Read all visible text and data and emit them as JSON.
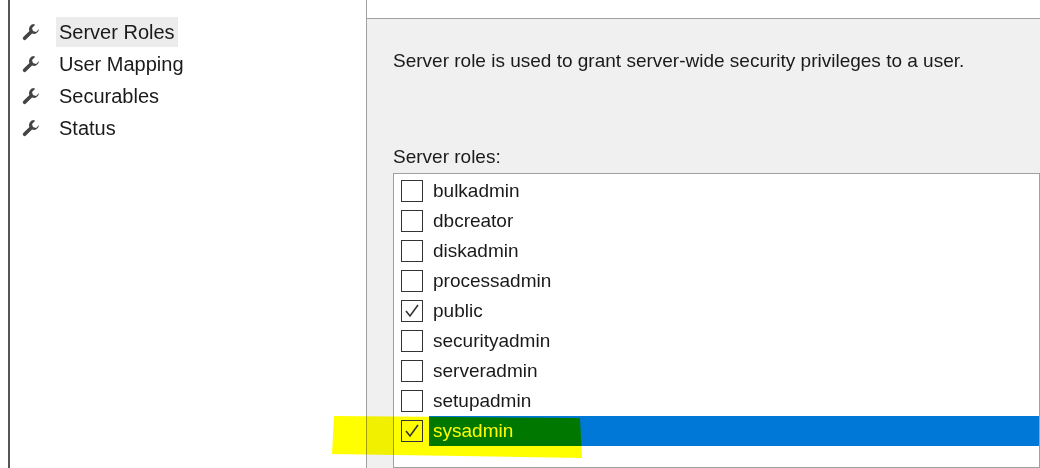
{
  "sidebar": {
    "items": [
      {
        "label": "Server Roles",
        "selected": true
      },
      {
        "label": "User Mapping",
        "selected": false
      },
      {
        "label": "Securables",
        "selected": false
      },
      {
        "label": "Status",
        "selected": false
      }
    ]
  },
  "description": "Server role is used to grant server-wide security privileges to a user.",
  "roles": {
    "label": "Server roles:",
    "items": [
      {
        "label": "bulkadmin",
        "checked": false,
        "selected": false,
        "highlighted": false
      },
      {
        "label": "dbcreator",
        "checked": false,
        "selected": false,
        "highlighted": false
      },
      {
        "label": "diskadmin",
        "checked": false,
        "selected": false,
        "highlighted": false
      },
      {
        "label": "processadmin",
        "checked": false,
        "selected": false,
        "highlighted": false
      },
      {
        "label": "public",
        "checked": true,
        "selected": false,
        "highlighted": false
      },
      {
        "label": "securityadmin",
        "checked": false,
        "selected": false,
        "highlighted": false
      },
      {
        "label": "serveradmin",
        "checked": false,
        "selected": false,
        "highlighted": false
      },
      {
        "label": "setupadmin",
        "checked": false,
        "selected": false,
        "highlighted": false
      },
      {
        "label": "sysadmin",
        "checked": true,
        "selected": true,
        "highlighted": true
      }
    ]
  }
}
